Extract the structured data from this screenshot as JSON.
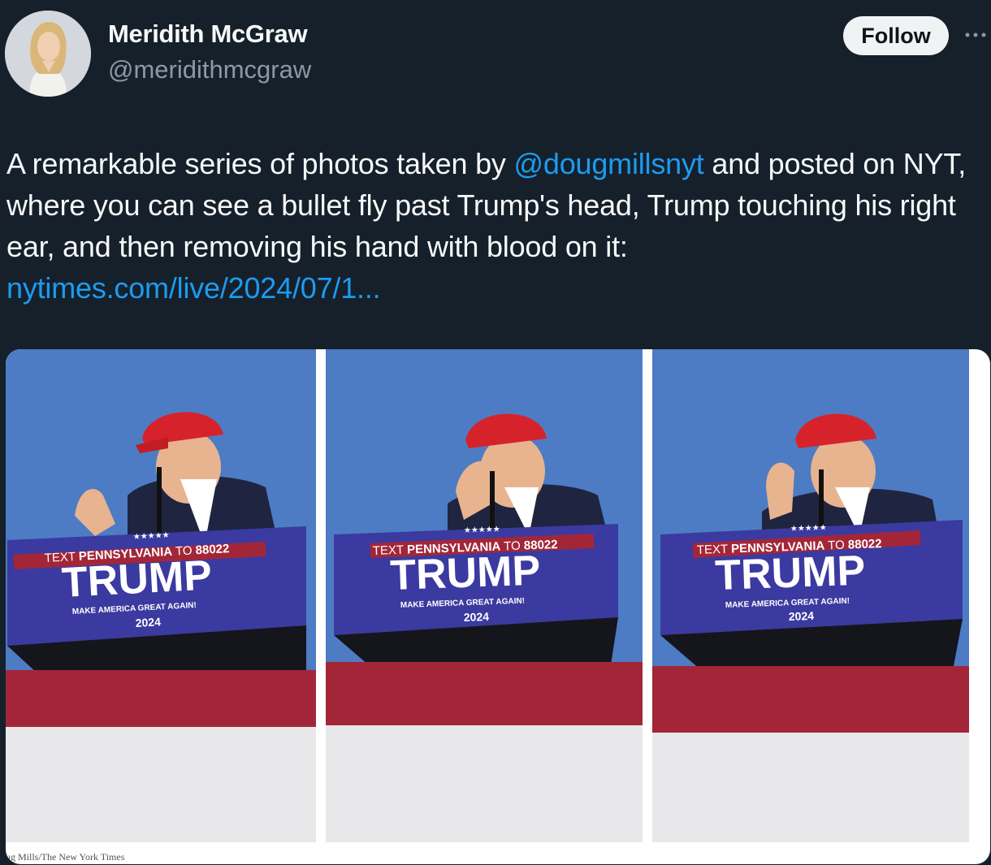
{
  "author": {
    "name": "Meridith McGraw",
    "handle": "@meridithmcgraw"
  },
  "actions": {
    "follow_label": "Follow",
    "more_icon": "more-dots-icon"
  },
  "tweet": {
    "text_before_mention": "A remarkable series of photos taken by ",
    "mention": "@dougmillsnyt",
    "text_after_mention": " and posted on NYT, where you can see a bullet fly past Trump's head, Trump touching his right ear, and then removing his hand with blood on it:",
    "link": "nytimes.com/live/2024/07/1..."
  },
  "media": {
    "photos": [
      {
        "sign_line1": "TEXT ",
        "sign_line1_bold": "PENNSYLVANIA",
        "sign_line1_end": " TO ",
        "sign_number": "88022",
        "sign_name": "TRUMP",
        "sign_slogan": "MAKE AMERICA GREAT AGAIN!",
        "sign_year": "2024",
        "stars": "★★★★★"
      },
      {
        "sign_line1": "TEXT ",
        "sign_line1_bold": "PENNSYLVANIA",
        "sign_line1_end": " TO ",
        "sign_number": "88022",
        "sign_name": "TRUMP",
        "sign_slogan": "MAKE AMERICA GREAT AGAIN!",
        "sign_year": "2024",
        "stars": "★★★★★"
      },
      {
        "sign_line1": "TEXT ",
        "sign_line1_bold": "PENNSYLVANIA",
        "sign_line1_end": " TO ",
        "sign_number": "88022",
        "sign_name": "TRUMP",
        "sign_slogan": "MAKE AMERICA GREAT AGAIN!",
        "sign_year": "2024",
        "stars": "★★★★★"
      }
    ],
    "caption": "ug Mills/The New York Times"
  },
  "colors": {
    "background": "#15202b",
    "link": "#1d9bf0",
    "sky": "#4d7cc4",
    "sign": "#3b3aa0",
    "banner_red": "#a32638"
  }
}
